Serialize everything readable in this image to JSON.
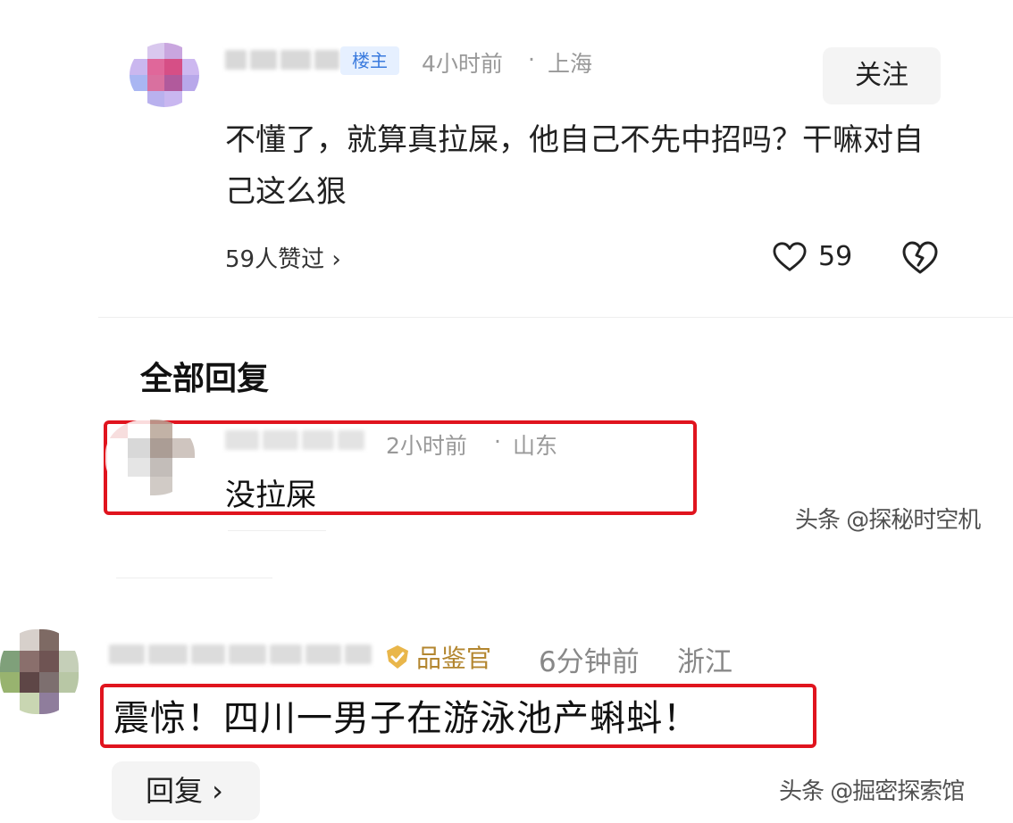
{
  "first_comment": {
    "badge": "楼主",
    "time": "4小时前",
    "separator": "·",
    "location": "上海",
    "follow_label": "关注",
    "body": "不懂了，就算真拉屎，他自己不先中招吗？干嘛对自己这么狠",
    "likes_summary": "59人赞过 ›",
    "like_count": "59",
    "icons": {
      "like": "heart-icon",
      "dislike": "broken-heart-icon"
    }
  },
  "replies_section": {
    "title": "全部回复",
    "reply": {
      "time": "2小时前",
      "separator": "·",
      "location": "山东",
      "body": "没拉屎"
    }
  },
  "second_comment": {
    "badge": "品鉴官",
    "time": "6分钟前",
    "location": "浙江",
    "body": "震惊！四川一男子在游泳池产蝌蚪！",
    "reply_button": "回复 ›",
    "icons": {
      "badge": "check-shield-icon"
    }
  },
  "watermarks": {
    "top": "头条 @探秘时空机",
    "bottom": "头条 @掘密探索馆"
  },
  "colors": {
    "highlight_border": "#e0141e",
    "owner_badge_bg": "#e6f0ff",
    "owner_badge_text": "#3b7bde",
    "judge_badge_text": "#b3862f",
    "meta_text": "#999999"
  }
}
